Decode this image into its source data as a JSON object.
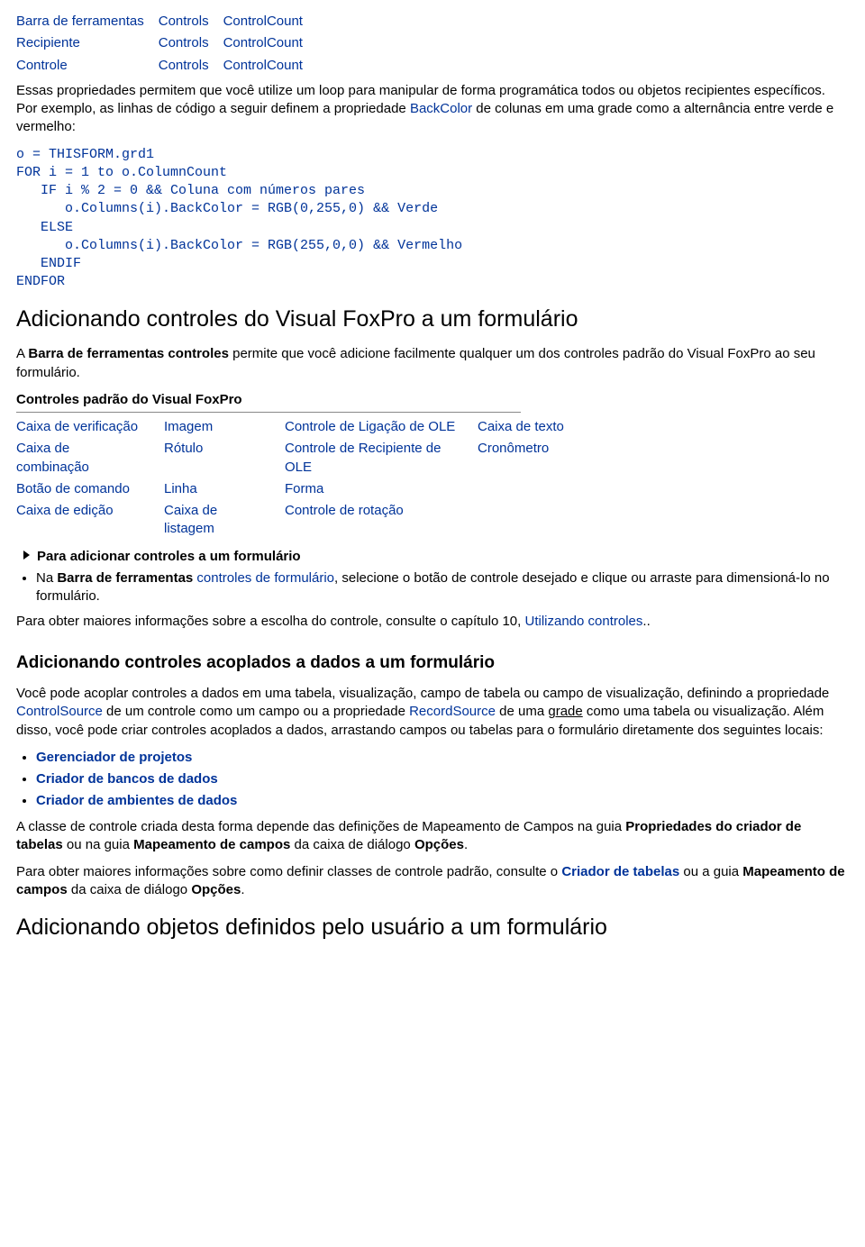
{
  "top_table": {
    "rows": [
      [
        "Barra de ferramentas",
        "Controls",
        "ControlCount"
      ],
      [
        "Recipiente",
        "Controls",
        "ControlCount"
      ],
      [
        "Controle",
        "Controls",
        "ControlCount"
      ]
    ]
  },
  "intro_para": {
    "pre": "Essas propriedades permitem que você utilize um loop para manipular de forma programática todos ou objetos recipientes específicos. Por exemplo, as linhas de código a seguir definem a propriedade ",
    "link1": "BackColor",
    "mid": " de colunas em uma grade como a alternância entre verde e vermelho:"
  },
  "code_block": "o = THISFORM.grd1\nFOR i = 1 to o.ColumnCount\n   IF i % 2 = 0 && Coluna com números pares\n      o.Columns(i).BackColor = RGB(0,255,0) && Verde\n   ELSE\n      o.Columns(i).BackColor = RGB(255,0,0) && Vermelho\n   ENDIF\nENDFOR",
  "h_add_controls": "Adicionando controles do Visual FoxPro a um formulário",
  "para_add_controls": {
    "pre": "A ",
    "bold": "Barra de ferramentas controles",
    "post": " permite que você adicione facilmente qualquer um dos controles padrão do Visual FoxPro ao seu formulário."
  },
  "std_controls_label": "Controles padrão do Visual FoxPro",
  "controls_table": {
    "rows": [
      [
        "Caixa de verificação",
        "Imagem",
        "Controle de Ligação de OLE",
        "Caixa de texto"
      ],
      [
        "Caixa de combinação",
        "Rótulo",
        "Controle de Recipiente de OLE",
        "Cronômetro"
      ],
      [
        "Botão de comando",
        "Linha",
        "Forma",
        ""
      ],
      [
        "Caixa de edição",
        "Caixa de listagem",
        "Controle de rotação",
        ""
      ]
    ]
  },
  "triangle_line": "Para adicionar controles a um formulário",
  "add_bullet": {
    "pre": "Na ",
    "bold1": "Barra de ferramentas",
    "link": " controles de formulário",
    "post": ", selecione o botão de controle desejado e clique ou arraste para dimensioná-lo no formulário."
  },
  "more_info": {
    "pre": "Para obter maiores informações sobre a escolha do controle, consulte o capítulo 10, ",
    "link": "Utilizando controles",
    "post": ".."
  },
  "h_bound": "Adicionando controles acoplados a dados a um formulário",
  "para_bound": {
    "t1": "Você pode acoplar controles a dados em uma tabela, visualização, campo de tabela ou campo de visualização, definindo a propriedade ",
    "l1": "ControlSource",
    "t2": " de um controle como um campo ou a propriedade ",
    "l2": "RecordSource",
    "t3": " de uma ",
    "u1": "grade",
    "t4": " como uma tabela ou visualização. Além disso, você pode criar controles acoplados a dados, arrastando campos ou tabelas para o formulário diretamente dos seguintes locais:"
  },
  "blue_bullets": [
    "Gerenciador de projetos",
    "Criador de bancos de dados",
    "Criador de ambientes de dados"
  ],
  "para_class": {
    "t1": "A classe de controle criada desta forma depende das definições de Mapeamento de Campos na guia ",
    "b1": "Propriedades do criador de tabelas",
    "t2": " ou na guia ",
    "b2": "Mapeamento de campos",
    "t3": " da caixa de diálogo ",
    "b3": "Opções",
    "t4": "."
  },
  "para_more2": {
    "t1": "Para obter maiores informações sobre como definir classes de controle padrão, consulte o ",
    "lb1": "Criador de tabelas",
    "t2": " ou a guia ",
    "b1": "Mapeamento de campos",
    "t3": " da caixa de diálogo ",
    "b2": "Opções",
    "t4": "."
  },
  "h_user_objects": "Adicionando objetos definidos pelo usuário a um formulário"
}
